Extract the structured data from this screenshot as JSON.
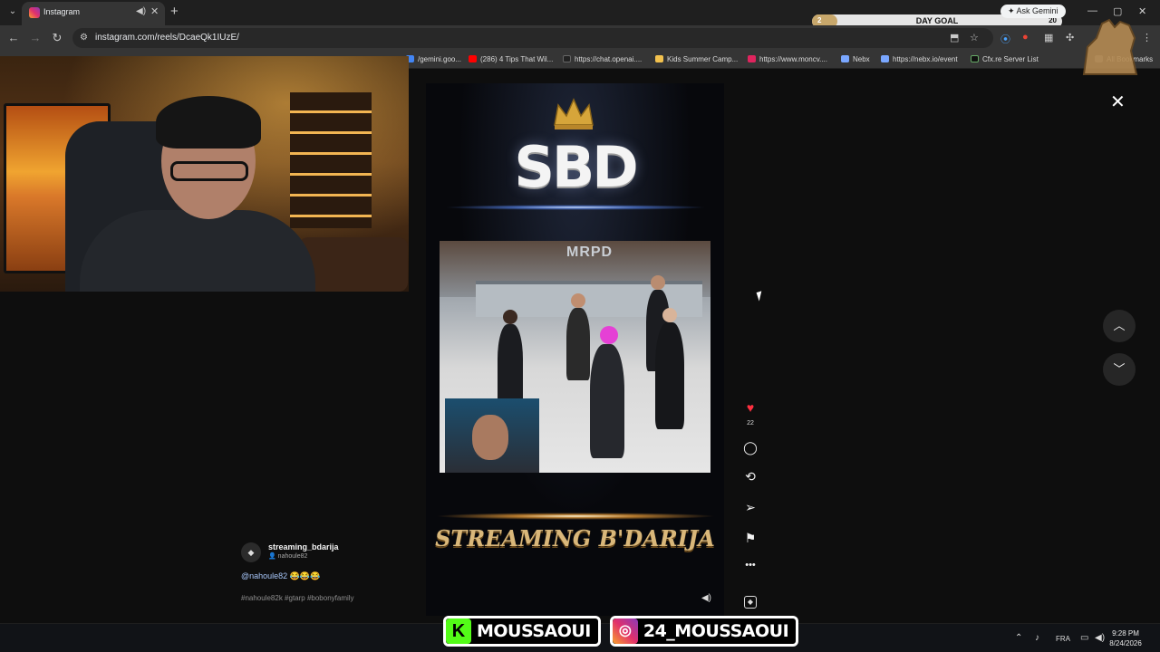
{
  "browser": {
    "tab_title": "Instagram",
    "url": "instagram.com/reels/DcaeQk1IUzE/",
    "ask_gemini": "Ask Gemini"
  },
  "day_goal": {
    "label": "DAY GOAL",
    "current": "2",
    "target": "20",
    "progress": 0.1
  },
  "bookmarks": [
    {
      "label": "/gemini.goo...",
      "color": "#4285f4"
    },
    {
      "label": "(286) 4 Tips That Wil...",
      "color": "#ff0000"
    },
    {
      "label": "https://chat.openai....",
      "color": "#222222"
    },
    {
      "label": "Kids Summer Camp...",
      "color": "#f2c14e"
    },
    {
      "label": "https://www.moncv....",
      "color": "#e0245e"
    },
    {
      "label": "Nebx",
      "color": "#7aa7ff"
    },
    {
      "label": "https://nebx.io/event",
      "color": "#7aa7ff"
    },
    {
      "label": "Cfx.re Server List",
      "color": "#111111"
    },
    {
      "label": "All Bookmarks",
      "color": "#888888"
    }
  ],
  "reel": {
    "logo_text": "SBD",
    "game_sign": "MRPD",
    "banner_text": "STREAMING B'DARIJA"
  },
  "actions": {
    "like_count": "22"
  },
  "caption": {
    "username": "streaming_bdarija",
    "sub_user": "nahoule82",
    "text": "@nahoule82 😂😂😂",
    "tags": "#nahoule82k #gtarp #bobonyfamily"
  },
  "overlay": {
    "kick_name": "MOUSSAOUI",
    "instagram_name": "24_MOUSSAOUI"
  },
  "taskbar": {
    "lang": "FRA",
    "time": "9:28 PM",
    "date": "8/24/2026"
  },
  "colors": {
    "like": "#ff3040",
    "kick": "#53fc18",
    "gold": "#d9b77a"
  }
}
